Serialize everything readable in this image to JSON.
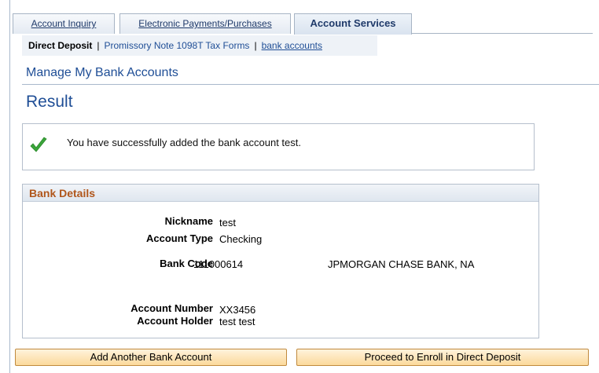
{
  "tabs": [
    {
      "label": "Account Inquiry",
      "active": false
    },
    {
      "label": "Electronic Payments/Purchases",
      "active": false
    },
    {
      "label": "Account Services",
      "active": true
    }
  ],
  "subnav": {
    "current": "Direct Deposit",
    "separator": "|",
    "link1": "Promissory Note 1098T Tax Forms",
    "link2": "bank accounts"
  },
  "page": {
    "section_title": "Manage My Bank Accounts",
    "result_title": "Result",
    "success_message": "You have successfully added the bank account test."
  },
  "bank_details": {
    "title": "Bank Details",
    "nickname_label": "Nickname",
    "nickname": "test",
    "account_type_label": "Account Type",
    "account_type": "Checking",
    "bank_code_label": "Bank Code",
    "bank_code": "111000614",
    "bank_name": "JPMORGAN CHASE BANK, NA",
    "account_number_label": "Account Number",
    "account_number": "XX3456",
    "account_holder_label": "Account Holder",
    "account_holder": "test test"
  },
  "buttons": {
    "add_another": "Add Another Bank Account",
    "proceed": "Proceed to Enroll in Direct Deposit"
  },
  "colors": {
    "link_blue": "#1f4e96",
    "section_orange": "#b0561b",
    "success_green": "#3aa53a"
  },
  "icons": {
    "success": "checkmark-icon"
  }
}
